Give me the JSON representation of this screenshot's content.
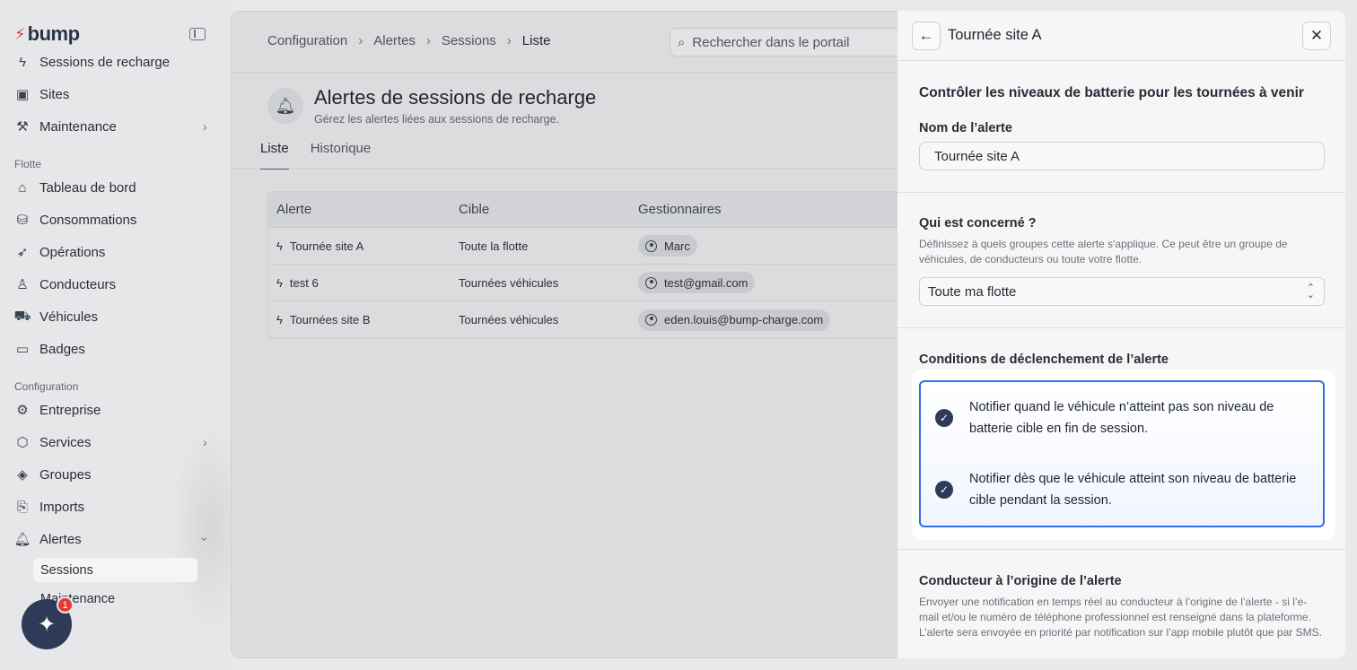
{
  "brand": {
    "name": "bump",
    "accent": "#e53935"
  },
  "sidebar": {
    "top_items": [
      {
        "label": "Sessions de recharge",
        "icon": "bolt-icon"
      },
      {
        "label": "Sites",
        "icon": "sites-icon"
      },
      {
        "label": "Maintenance",
        "icon": "wrench-icon"
      }
    ],
    "fleet_label": "Flotte",
    "fleet_items": [
      {
        "label": "Tableau de bord",
        "icon": "home-icon"
      },
      {
        "label": "Consommations",
        "icon": "database-icon"
      },
      {
        "label": "Opérations",
        "icon": "rocket-icon"
      },
      {
        "label": "Conducteurs",
        "icon": "user-icon"
      },
      {
        "label": "Véhicules",
        "icon": "car-icon"
      },
      {
        "label": "Badges",
        "icon": "badge-icon"
      }
    ],
    "config_label": "Configuration",
    "config_items": [
      {
        "label": "Entreprise",
        "icon": "gear-icon"
      },
      {
        "label": "Services",
        "icon": "cube-icon"
      },
      {
        "label": "Groupes",
        "icon": "layers-icon"
      },
      {
        "label": "Imports",
        "icon": "file-import-icon"
      },
      {
        "label": "Alertes",
        "icon": "bell-icon"
      }
    ],
    "alert_sub_items": [
      {
        "label": "Sessions"
      },
      {
        "label": "Maintenance"
      }
    ],
    "ai_badge_count": "1"
  },
  "header": {
    "breadcrumb": [
      "Configuration",
      "Alertes",
      "Sessions",
      "Liste"
    ],
    "search_placeholder": "Rechercher dans le portail"
  },
  "page": {
    "title": "Alertes de sessions de recharge",
    "subtitle": "Gérez les alertes liées aux sessions de recharge.",
    "tabs": [
      "Liste",
      "Historique"
    ]
  },
  "table": {
    "columns": [
      "Alerte",
      "Cible",
      "Gestionnaires"
    ],
    "rows": [
      {
        "alert": "Tournée site A",
        "target": "Toute la flotte",
        "manager": "Marc"
      },
      {
        "alert": "test 6",
        "target": "Tournées véhicules",
        "manager": "test@gmail.com"
      },
      {
        "alert": "Tournées site B",
        "target": "Tournées véhicules",
        "manager": "eden.louis@bump-charge.com"
      }
    ]
  },
  "drawer": {
    "title": "Tournée site A",
    "heading": "Contrôler les niveaux de batterie pour les tournées à venir",
    "name_label": "Nom de l’alerte",
    "name_value": "Tournée site A",
    "who_label": "Qui est concerné ?",
    "who_help": "Définissez à quels groupes cette alerte s'applique. Ce peut être un groupe de véhicules, de conducteurs ou toute votre flotte.",
    "who_value": "Toute ma flotte",
    "conditions_label": "Conditions de déclenchement de l’alerte",
    "conditions": [
      {
        "text": "Notifier quand le véhicule n’atteint pas son niveau de batterie cible en fin de session.",
        "checked": true
      },
      {
        "text": "Notifier dès que le véhicule atteint son niveau de batterie cible pendant la session.",
        "checked": true
      }
    ],
    "driver_label": "Conducteur à l’origine de l’alerte",
    "driver_help": "Envoyer une notification en temps réel au conducteur à l’origine de l’alerte - si l’e-mail et/ou le numéro de téléphone professionnel est renseigné dans la plateforme. L’alerte sera envoyée en priorité par notification sur l’app mobile plutôt que par SMS."
  },
  "colors": {
    "focus_border": "#2f6fe0",
    "checkbox": "#2d3b58"
  }
}
